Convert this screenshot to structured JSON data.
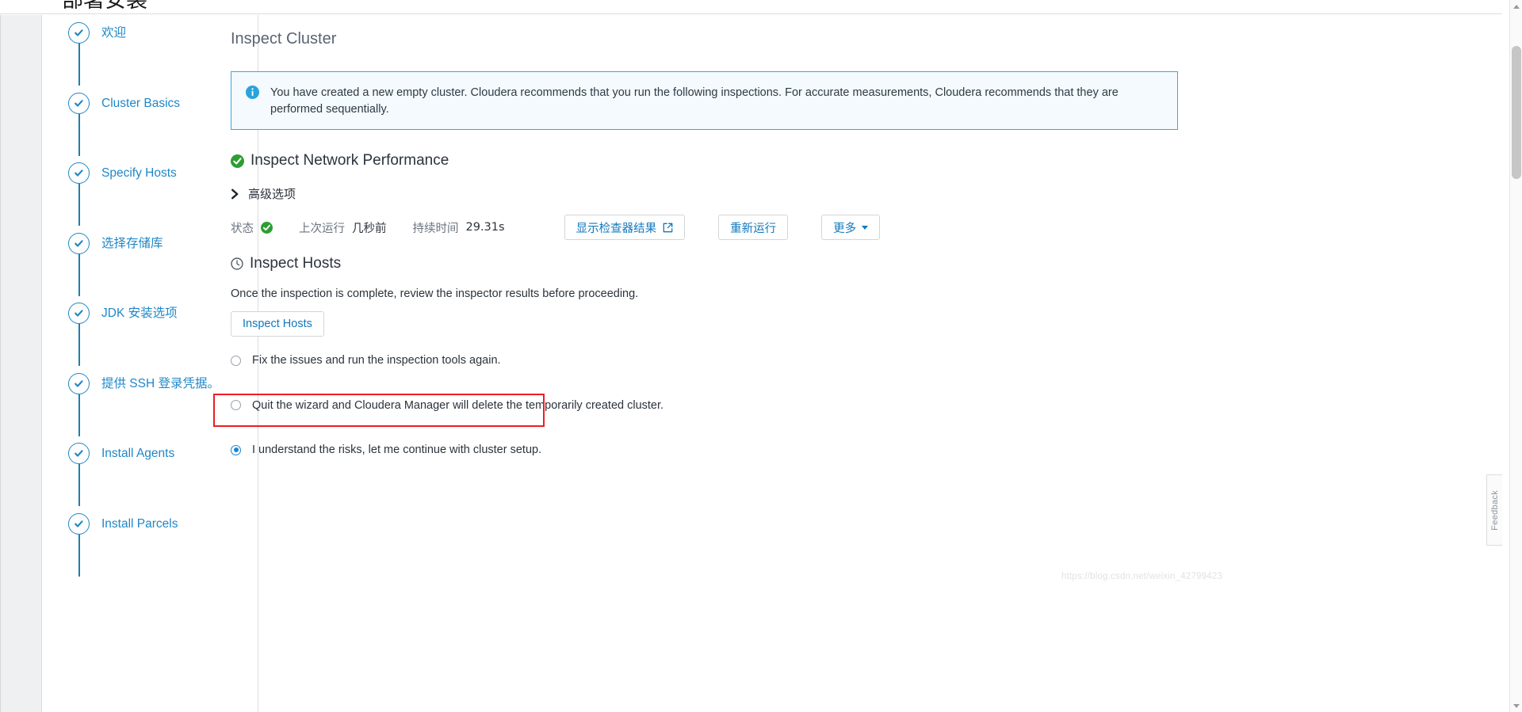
{
  "window": {
    "cut_off_heading": "部署安装",
    "watermark": "https://blog.csdn.net/weixin_42799423",
    "feedback_tab_label": "Feedback"
  },
  "sidebar": {
    "items": [
      {
        "label": "欢迎",
        "state": "complete",
        "icon": "check-circle-icon"
      },
      {
        "label": "Cluster Basics",
        "state": "complete",
        "icon": "check-circle-icon"
      },
      {
        "label": "Specify Hosts",
        "state": "complete",
        "icon": "check-circle-icon"
      },
      {
        "label": "选择存储库",
        "state": "complete",
        "icon": "check-circle-icon"
      },
      {
        "label": "JDK 安装选项",
        "state": "complete",
        "icon": "check-circle-icon"
      },
      {
        "label": "提供 SSH 登录凭据。",
        "state": "complete",
        "icon": "check-circle-icon"
      },
      {
        "label": "Install Agents",
        "state": "complete",
        "icon": "check-circle-icon"
      },
      {
        "label": "Install Parcels",
        "state": "complete",
        "icon": "check-circle-icon"
      }
    ]
  },
  "main": {
    "page_title": "Inspect Cluster",
    "info_banner": {
      "icon": "info-circle-icon",
      "text": "You have created a new empty cluster. Cloudera recommends that you run the following inspections. For accurate measurements, Cloudera recommends that they are performed sequentially.",
      "accent_color": "#36a8dd",
      "background_color": "#f4fafd"
    },
    "network_section": {
      "icon": "check-circle-filled-icon",
      "status_color": "#2c9e32",
      "title": "Inspect Network Performance",
      "advanced_toggle": {
        "icon": "chevron-right-icon",
        "label": "高级选项",
        "expanded": false
      },
      "status": {
        "status_key": "状态",
        "status_icon": "check-circle-filled-icon",
        "last_run_key": "上次运行",
        "last_run_value": "几秒前",
        "duration_key": "持续时间",
        "duration_value": "29.31s"
      },
      "buttons": [
        {
          "label": "显示检查器结果",
          "icon": "external-link-icon",
          "type": "link-out"
        },
        {
          "label": "重新运行",
          "icon": "",
          "type": "plain"
        },
        {
          "label": "更多",
          "icon": "caret-down-icon",
          "type": "dropdown"
        }
      ]
    },
    "hosts_section": {
      "icon": "clock-icon",
      "title": "Inspect Hosts",
      "description": "Once the inspection is complete, review the inspector results before proceeding.",
      "action_button": "Inspect Hosts",
      "options": [
        {
          "label": "Fix the issues and run the inspection tools again.",
          "selected": false
        },
        {
          "label": "Quit the wizard and Cloudera Manager will delete the temporarily created cluster.",
          "selected": false
        },
        {
          "label": "I understand the risks, let me continue with cluster setup.",
          "selected": true
        }
      ],
      "annotation": {
        "color": "#ee1c25",
        "targets_option_index": 2
      }
    }
  }
}
